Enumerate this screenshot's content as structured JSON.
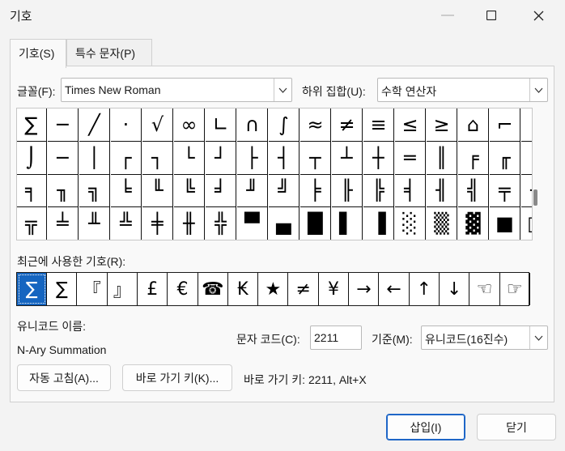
{
  "window": {
    "title": "기호"
  },
  "tabs": [
    {
      "label": "기호(S)"
    },
    {
      "label": "특수 문자(P)"
    }
  ],
  "font": {
    "label": "글꼴(F):",
    "value": "Times New Roman"
  },
  "subset": {
    "label": "하위 집합(U):",
    "value": "수학 연산자"
  },
  "symbols": [
    [
      "∑",
      "─",
      "╱",
      "·",
      "√",
      "∞",
      "∟",
      "∩",
      "∫",
      "≈",
      "≠",
      "≡",
      "≤",
      "≥",
      "⌂",
      "⌐",
      "⌠"
    ],
    [
      "⌡",
      "─",
      "│",
      "┌",
      "┐",
      "└",
      "┘",
      "├",
      "┤",
      "┬",
      "┴",
      "┼",
      "═",
      "║",
      "╒",
      "╓",
      "╔"
    ],
    [
      "╕",
      "╖",
      "╗",
      "╘",
      "╙",
      "╚",
      "╛",
      "╜",
      "╝",
      "╞",
      "╟",
      "╠",
      "╡",
      "╢",
      "╣",
      "╤",
      "╥"
    ],
    [
      "╦",
      "╧",
      "╨",
      "╩",
      "╪",
      "╫",
      "╬",
      "▀",
      "▄",
      "█",
      "▌",
      "▐",
      "░",
      "▒",
      "▓",
      "■",
      "□"
    ]
  ],
  "recent": {
    "label": "최근에 사용한 기호(R):",
    "items": [
      "∑",
      "∑",
      "『",
      "』",
      "£",
      "€",
      "☎",
      "₭",
      "★",
      "≠",
      "¥",
      "→",
      "←",
      "↑",
      "↓",
      "☜",
      "☞"
    ]
  },
  "unicode_name": {
    "label": "유니코드 이름:",
    "value": "N-Ary Summation"
  },
  "char_code": {
    "label": "문자 코드(C):",
    "value": "2211"
  },
  "from": {
    "label": "기준(M):",
    "value": "유니코드(16진수)"
  },
  "buttons": {
    "autocorrect": "자동 고침(A)...",
    "shortcut_key": "바로 가기 키(K)...",
    "shortcut_text": "바로 가기 키: 2211, Alt+X",
    "insert": "삽입(I)",
    "close": "닫기"
  }
}
